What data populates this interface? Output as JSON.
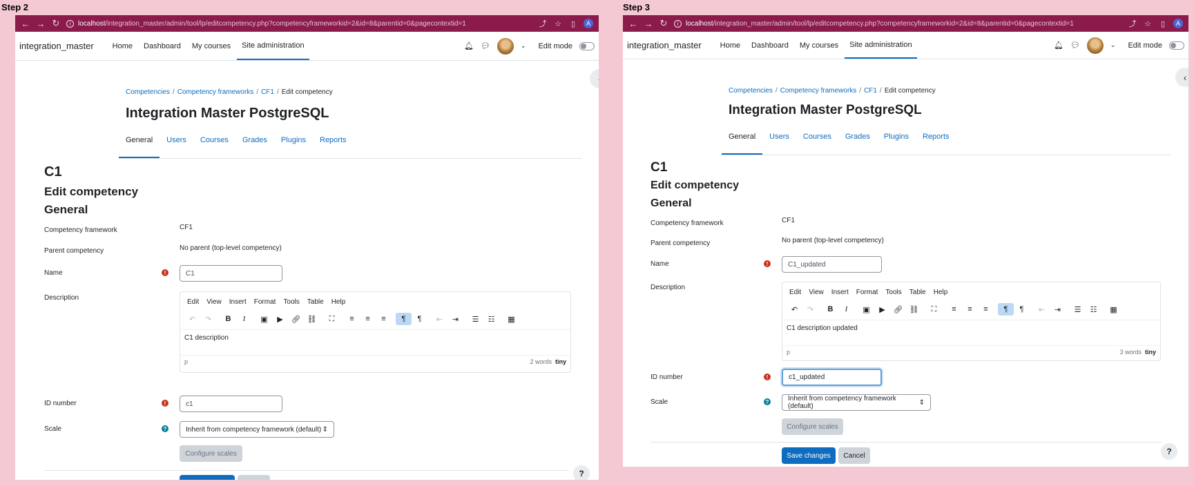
{
  "steps": [
    "Step 2",
    "Step 3"
  ],
  "browser": {
    "url_host": "localhost",
    "url_path": "/integration_master/admin/tool/lp/editcompetency.php?competencyframeworkid=2&id=8&parentid=0&pagecontextid=1",
    "profile_initial": "A"
  },
  "navbar": {
    "brand": "integration_master",
    "links": [
      "Home",
      "Dashboard",
      "My courses",
      "Site administration"
    ],
    "edit_mode": "Edit mode"
  },
  "breadcrumb": [
    "Competencies",
    "Competency frameworks",
    "CF1",
    "Edit competency"
  ],
  "site_title": "Integration Master PostgreSQL",
  "tabs": [
    "General",
    "Users",
    "Courses",
    "Grades",
    "Plugins",
    "Reports"
  ],
  "page": {
    "heading": "C1",
    "subheading": "Edit competency",
    "section": "General"
  },
  "form": {
    "labels": {
      "framework": "Competency framework",
      "parent": "Parent competency",
      "name": "Name",
      "description": "Description",
      "idnumber": "ID number",
      "scale": "Scale"
    },
    "framework_value": "CF1",
    "parent_value": "No parent (top-level competency)",
    "scale_value": "Inherit from competency framework (default)",
    "configure_scales": "Configure scales",
    "save": "Save changes",
    "cancel": "Cancel"
  },
  "editor": {
    "menus": [
      "Edit",
      "View",
      "Insert",
      "Format",
      "Tools",
      "Table",
      "Help"
    ],
    "path": "p",
    "brand": "tiny"
  },
  "left": {
    "name_value": "C1",
    "description": "C1 description",
    "word_count": "2 words",
    "idnumber_value": "c1"
  },
  "right": {
    "name_value": "C1_updated",
    "description": "C1 description updated",
    "word_count": "3 words",
    "idnumber_value": "c1_updated"
  },
  "help_button": "?",
  "colors": {
    "browser_chrome": "#8a1b4b",
    "primary": "#0f6cbf",
    "required": "#ca3120",
    "help": "#008196",
    "page_bg": "#f5c9d3"
  }
}
